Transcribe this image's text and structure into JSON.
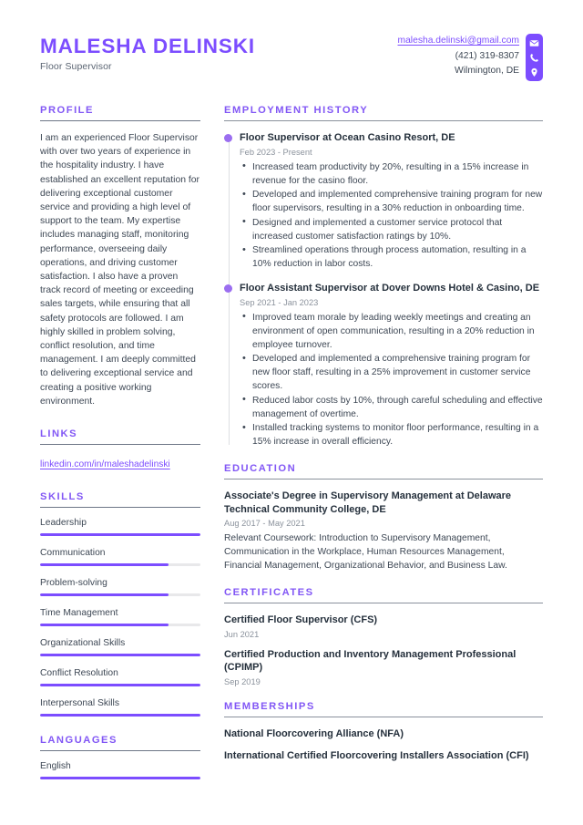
{
  "header": {
    "full_name": "MALESHA DELINSKI",
    "job_title": "Floor Supervisor",
    "email": "malesha.delinski@gmail.com",
    "phone": "(421) 319-8307",
    "location": "Wilmington, DE",
    "icons": [
      "envelope-icon",
      "phone-icon",
      "location-pin-icon"
    ]
  },
  "colors": {
    "accent": "#7c4dff",
    "heading": "#8257f5",
    "body_text": "#3d4754",
    "muted_text": "#8b929c",
    "rule": "#6d7686",
    "track": "#e8e8ea",
    "timeline_line": "#dddfe3",
    "timeline_dot": "#9b6ef0"
  },
  "sidebar": {
    "profile": {
      "title": "PROFILE",
      "text": "I am an experienced Floor Supervisor with over two years of experience in the hospitality industry. I have established an excellent reputation for delivering exceptional customer service and providing a high level of support to the team. My expertise includes managing staff, monitoring performance, overseeing daily operations, and driving customer satisfaction. I also have a proven track record of meeting or exceeding sales targets, while ensuring that all safety protocols are followed. I am highly skilled in problem solving, conflict resolution, and time management. I am deeply committed to delivering exceptional service and creating a positive working environment."
    },
    "links": {
      "title": "LINKS",
      "items": [
        {
          "label": "linkedin.com/in/maleshadelinski"
        }
      ]
    },
    "skills": {
      "title": "SKILLS",
      "items": [
        {
          "name": "Leadership",
          "level": 100
        },
        {
          "name": "Communication",
          "level": 80
        },
        {
          "name": "Problem-solving",
          "level": 80
        },
        {
          "name": "Time Management",
          "level": 80
        },
        {
          "name": "Organizational Skills",
          "level": 100
        },
        {
          "name": "Conflict Resolution",
          "level": 100
        },
        {
          "name": "Interpersonal Skills",
          "level": 100
        }
      ]
    },
    "languages": {
      "title": "LANGUAGES",
      "items": [
        {
          "name": "English",
          "level": 100
        }
      ]
    }
  },
  "main": {
    "employment": {
      "title": "EMPLOYMENT HISTORY",
      "jobs": [
        {
          "title": "Floor Supervisor at Ocean Casino Resort, DE",
          "date": "Feb 2023 - Present",
          "bullets": [
            "Increased team productivity by 20%, resulting in a 15% increase in revenue for the casino floor.",
            "Developed and implemented comprehensive training program for new floor supervisors, resulting in a 30% reduction in onboarding time.",
            "Designed and implemented a customer service protocol that increased customer satisfaction ratings by 10%.",
            "Streamlined operations through process automation, resulting in a 10% reduction in labor costs."
          ]
        },
        {
          "title": "Floor Assistant Supervisor at Dover Downs Hotel & Casino, DE",
          "date": "Sep 2021 - Jan 2023",
          "bullets": [
            "Improved team morale by leading weekly meetings and creating an environment of open communication, resulting in a 20% reduction in employee turnover.",
            "Developed and implemented a comprehensive training program for new floor staff, resulting in a 25% improvement in customer service scores.",
            "Reduced labor costs by 10%, through careful scheduling and effective management of overtime.",
            "Installed tracking systems to monitor floor performance, resulting in a 15% increase in overall efficiency."
          ]
        }
      ]
    },
    "education": {
      "title": "EDUCATION",
      "entries": [
        {
          "title": "Associate's Degree in Supervisory Management at Delaware Technical Community College, DE",
          "date": "Aug 2017 - May 2021",
          "description": "Relevant Coursework: Introduction to Supervisory Management, Communication in the Workplace, Human Resources Management, Financial Management, Organizational Behavior, and Business Law."
        }
      ]
    },
    "certificates": {
      "title": "CERTIFICATES",
      "entries": [
        {
          "title": "Certified Floor Supervisor (CFS)",
          "date": "Jun 2021"
        },
        {
          "title": "Certified Production and Inventory Management Professional (CPIMP)",
          "date": "Sep 2019"
        }
      ]
    },
    "memberships": {
      "title": "MEMBERSHIPS",
      "entries": [
        {
          "title": "National Floorcovering Alliance (NFA)"
        },
        {
          "title": "International Certified Floorcovering Installers Association (CFI)"
        }
      ]
    }
  }
}
